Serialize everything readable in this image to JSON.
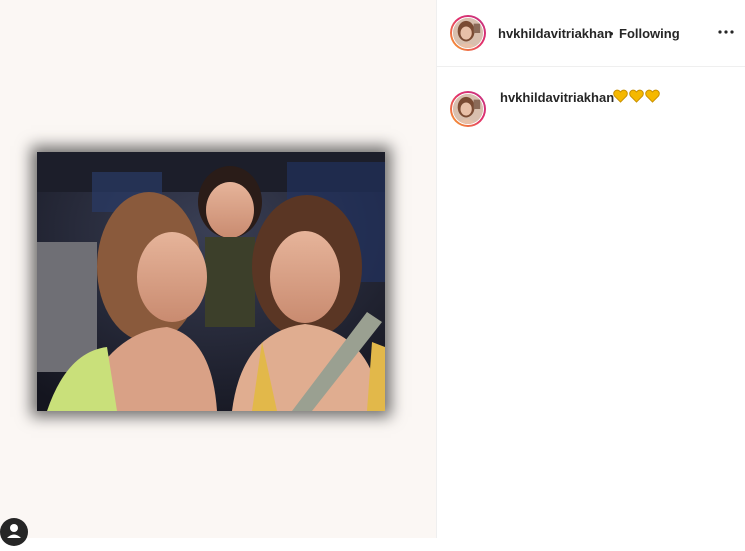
{
  "post": {
    "username": "hvkhildavitriakhan",
    "separator": "•",
    "follow_status": "Following",
    "more_icon": "more-horizontal-icon"
  },
  "caption": {
    "username": "hvkhildavitriakhan",
    "emojis": [
      "yellow-heart",
      "yellow-heart",
      "yellow-heart"
    ]
  },
  "colors": {
    "heart": "#f5b800",
    "heart_outline": "#c78f00",
    "media_background": "#fbf7f4"
  }
}
